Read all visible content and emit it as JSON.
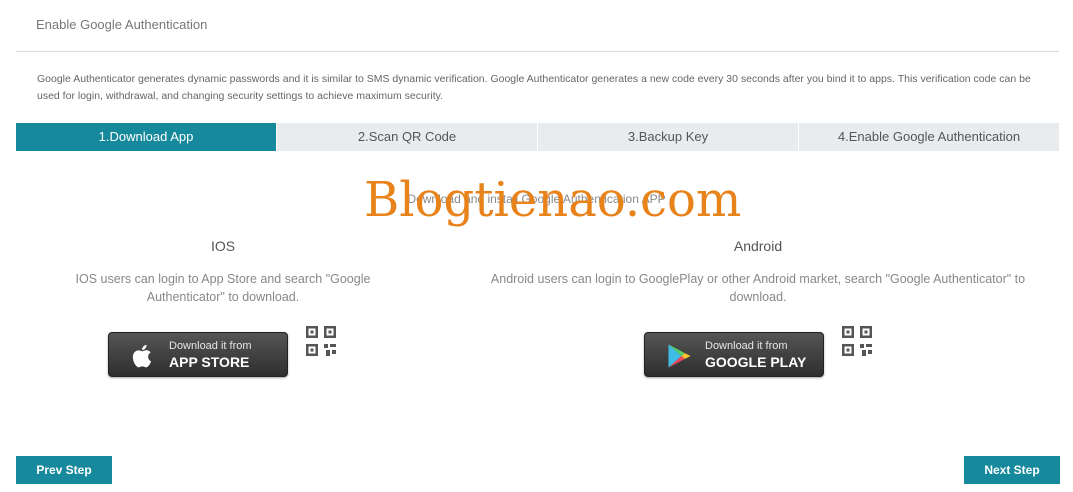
{
  "header": {
    "title": "Enable Google Authentication"
  },
  "description": "Google Authenticator generates dynamic passwords and it is similar to SMS dynamic verification. Google Authenticator generates a new code every 30 seconds after you bind it to apps. This verification code can be used for login, withdrawal, and changing security settings to achieve maximum security.",
  "steps": [
    {
      "label": "1.Download App",
      "active": true
    },
    {
      "label": "2.Scan QR Code",
      "active": false
    },
    {
      "label": "3.Backup Key",
      "active": false
    },
    {
      "label": "4.Enable Google Authentication",
      "active": false
    }
  ],
  "step_heading": "Download and install Google Authentication APP",
  "watermark": "Blogtienao.com",
  "ios": {
    "title": "IOS",
    "description": "IOS users can login to App Store and search \"Google Authenticator\" to download.",
    "button_small": "Download it from",
    "button_big": "APP STORE",
    "icon": "apple-icon"
  },
  "android": {
    "title": "Android",
    "description": "Android users can login to GooglePlay or other Android market, search \"Google Authenticator\" to download.",
    "button_small": "Download it from",
    "button_big": "GOOGLE PLAY",
    "icon": "google-play-icon"
  },
  "nav": {
    "prev_label": "Prev Step",
    "next_label": "Next Step"
  },
  "colors": {
    "accent": "#168a9c",
    "watermark": "#e8821a",
    "tab_inactive": "#e9ecef"
  }
}
